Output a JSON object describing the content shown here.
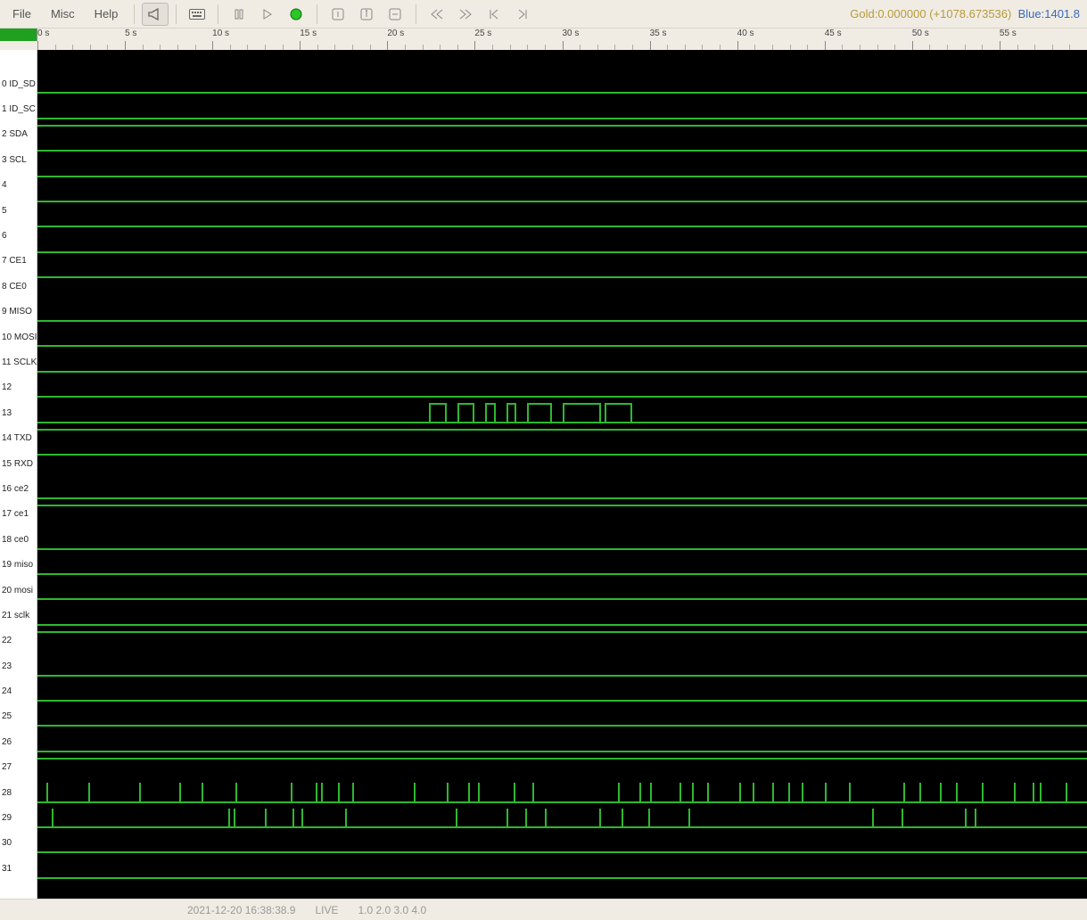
{
  "menu": {
    "file": "File",
    "misc": "Misc",
    "help": "Help"
  },
  "cursors": {
    "gold_label": "Gold:",
    "gold_value": "0.000000",
    "gold_delta": "(+1078.673536)",
    "blue_label": "Blue:",
    "blue_value": "1401.8"
  },
  "time_window_s": 60,
  "ruler_step_s": 5,
  "channels": [
    {
      "id": 0,
      "label": "0 ID_SD",
      "level": "low"
    },
    {
      "id": 1,
      "label": "1 ID_SC",
      "level": "low"
    },
    {
      "id": 2,
      "label": "2 SDA",
      "level": "high"
    },
    {
      "id": 3,
      "label": "3 SCL",
      "level": "high"
    },
    {
      "id": 4,
      "label": "4",
      "level": "high"
    },
    {
      "id": 5,
      "label": "5",
      "level": "high"
    },
    {
      "id": 6,
      "label": "6",
      "level": "high"
    },
    {
      "id": 7,
      "label": "7 CE1",
      "level": "high"
    },
    {
      "id": 8,
      "label": "8 CE0",
      "level": "high"
    },
    {
      "id": 9,
      "label": "9 MISO",
      "level": "low"
    },
    {
      "id": 10,
      "label": "10 MOSI",
      "level": "low"
    },
    {
      "id": 11,
      "label": "11 SCLK",
      "level": "low"
    },
    {
      "id": 12,
      "label": "12",
      "level": "low"
    },
    {
      "id": 13,
      "label": "13",
      "level": "pulses",
      "pulses": [
        {
          "start": 22.4,
          "end": 23.4
        },
        {
          "start": 24.0,
          "end": 25.0
        },
        {
          "start": 25.6,
          "end": 26.2
        },
        {
          "start": 26.8,
          "end": 27.4
        },
        {
          "start": 28.0,
          "end": 29.4
        },
        {
          "start": 30.0,
          "end": 32.2
        },
        {
          "start": 32.4,
          "end": 34.0
        }
      ]
    },
    {
      "id": 14,
      "label": "14 TXD",
      "level": "high"
    },
    {
      "id": 15,
      "label": "15 RXD",
      "level": "high"
    },
    {
      "id": 16,
      "label": "16 ce2",
      "level": "low"
    },
    {
      "id": 17,
      "label": "17 ce1",
      "level": "high"
    },
    {
      "id": 18,
      "label": "18 ce0",
      "level": "low"
    },
    {
      "id": 19,
      "label": "19 miso",
      "level": "low"
    },
    {
      "id": 20,
      "label": "20 mosi",
      "level": "low"
    },
    {
      "id": 21,
      "label": "21 sclk",
      "level": "low"
    },
    {
      "id": 22,
      "label": "22",
      "level": "high"
    },
    {
      "id": 23,
      "label": "23",
      "level": "low"
    },
    {
      "id": 24,
      "label": "24",
      "level": "low"
    },
    {
      "id": 25,
      "label": "25",
      "level": "low"
    },
    {
      "id": 26,
      "label": "26",
      "level": "low"
    },
    {
      "id": 27,
      "label": "27",
      "level": "high"
    },
    {
      "id": 28,
      "label": "28",
      "level": "spikes",
      "spikes": [
        0.5,
        2.9,
        5.8,
        8.1,
        9.4,
        11.3,
        14.5,
        15.9,
        16.2,
        17.2,
        18.0,
        21.5,
        23.4,
        24.6,
        25.2,
        27.2,
        28.3,
        33.2,
        34.4,
        35.0,
        36.7,
        37.4,
        38.3,
        40.1,
        40.9,
        42.0,
        42.9,
        43.7,
        45.0,
        46.4,
        49.5,
        50.4,
        51.6,
        52.5,
        54.0,
        55.8,
        56.9,
        57.3,
        58.8
      ]
    },
    {
      "id": 29,
      "label": "29",
      "level": "spikes",
      "spikes": [
        0.8,
        10.9,
        11.2,
        13.0,
        14.6,
        15.1,
        17.6,
        23.9,
        26.8,
        27.9,
        29.0,
        32.1,
        33.4,
        34.9,
        37.2,
        47.7,
        49.4,
        53.0,
        53.6
      ]
    },
    {
      "id": 30,
      "label": "30",
      "level": "low"
    },
    {
      "id": 31,
      "label": "31",
      "level": "low"
    }
  ],
  "status": {
    "timestamp": "2021-12-20 16:38:38.9",
    "mode": "LIVE",
    "indices": "1.0   2.0   3.0   4.0"
  },
  "colors": {
    "trace": "#2fb82f",
    "run_led": "#28c828"
  }
}
